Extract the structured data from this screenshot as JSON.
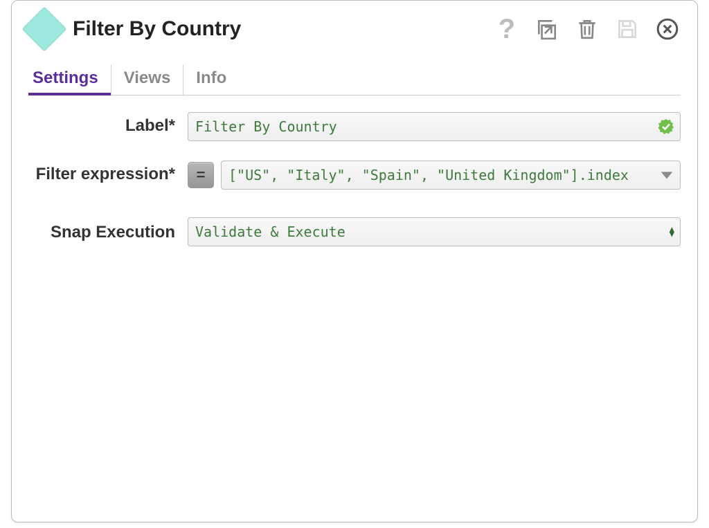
{
  "header": {
    "title": "Filter By Country"
  },
  "tabs": {
    "items": [
      {
        "label": "Settings"
      },
      {
        "label": "Views"
      },
      {
        "label": "Info"
      }
    ],
    "active_index": 0
  },
  "form": {
    "label": {
      "caption": "Label*",
      "value": "Filter By Country"
    },
    "filter_expression": {
      "caption": "Filter expression*",
      "eq_button": "=",
      "value": "[\"US\", \"Italy\", \"Spain\", \"United Kingdom\"].index"
    },
    "snap_execution": {
      "caption": "Snap Execution",
      "value": "Validate & Execute"
    }
  },
  "toolbar": {
    "help": "?",
    "popout": "popout-icon",
    "delete": "trash-icon",
    "save": "save-icon",
    "close": "close-icon"
  }
}
